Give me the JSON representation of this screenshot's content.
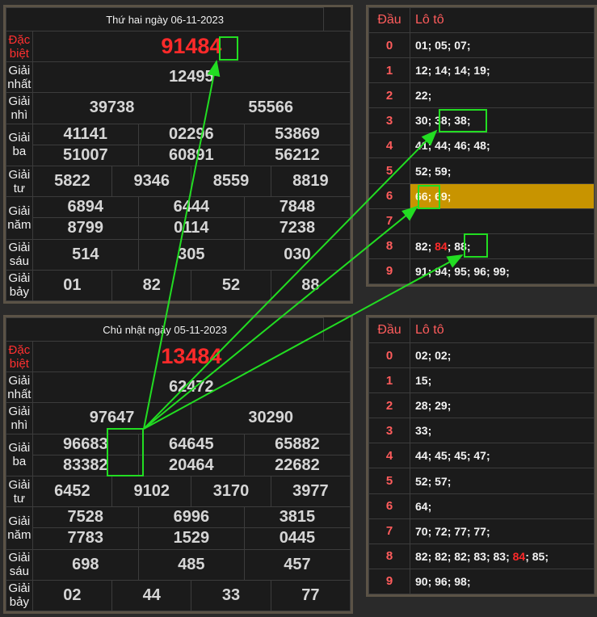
{
  "top_result": {
    "date": "Thứ hai ngày 06-11-2023",
    "rows": [
      {
        "label": "Đặc biệt",
        "nums": [
          "91484"
        ]
      },
      {
        "label": "Giải nhất",
        "nums": [
          "12495"
        ]
      },
      {
        "label": "Giải nhì",
        "nums": [
          "39738",
          "55566"
        ]
      },
      {
        "label": "Giải ba",
        "nums": [
          "41141",
          "02296",
          "53869",
          "51007",
          "60891",
          "56212"
        ]
      },
      {
        "label": "Giải tư",
        "nums": [
          "5822",
          "9346",
          "8559",
          "8819"
        ]
      },
      {
        "label": "Giải năm",
        "nums": [
          "6894",
          "6444",
          "7848",
          "8799",
          "0114",
          "7238"
        ]
      },
      {
        "label": "Giải sáu",
        "nums": [
          "514",
          "305",
          "030"
        ]
      },
      {
        "label": "Giải bảy",
        "nums": [
          "01",
          "82",
          "52",
          "88"
        ]
      }
    ]
  },
  "bottom_result": {
    "date": "Chủ nhật ngày 05-11-2023",
    "rows": [
      {
        "label": "Đặc biệt",
        "nums": [
          "13484"
        ]
      },
      {
        "label": "Giải nhất",
        "nums": [
          "62472"
        ]
      },
      {
        "label": "Giải nhì",
        "nums": [
          "97647",
          "30290"
        ]
      },
      {
        "label": "Giải ba",
        "nums": [
          "96683",
          "64645",
          "65882",
          "83382",
          "20464",
          "22682"
        ]
      },
      {
        "label": "Giải tư",
        "nums": [
          "6452",
          "9102",
          "3170",
          "3977"
        ]
      },
      {
        "label": "Giải năm",
        "nums": [
          "7528",
          "6996",
          "3815",
          "7783",
          "1529",
          "0445"
        ]
      },
      {
        "label": "Giải sáu",
        "nums": [
          "698",
          "485",
          "457"
        ]
      },
      {
        "label": "Giải bảy",
        "nums": [
          "02",
          "44",
          "33",
          "77"
        ]
      }
    ]
  },
  "top_loto": {
    "head_label": "Đầu",
    "value_label": "Lô tô",
    "rows": [
      {
        "d": "0",
        "v": "01; 05; 07;"
      },
      {
        "d": "1",
        "v": "12; 14; 14; 19;"
      },
      {
        "d": "2",
        "v": "22;"
      },
      {
        "d": "3",
        "v": "30; 38; 38;"
      },
      {
        "d": "4",
        "v": "41; 44; 46; 48;"
      },
      {
        "d": "5",
        "v": "52; 59;"
      },
      {
        "d": "6",
        "v": "66; 69;"
      },
      {
        "d": "7",
        "v": ""
      },
      {
        "d": "8",
        "v": "82; 84; 88;"
      },
      {
        "d": "9",
        "v": "91; 94; 95; 96; 99;"
      }
    ]
  },
  "bottom_loto": {
    "head_label": "Đầu",
    "value_label": "Lô tô",
    "rows": [
      {
        "d": "0",
        "v": "02; 02;"
      },
      {
        "d": "1",
        "v": "15;"
      },
      {
        "d": "2",
        "v": "28; 29;"
      },
      {
        "d": "3",
        "v": "33;"
      },
      {
        "d": "4",
        "v": "44; 45; 45; 47;"
      },
      {
        "d": "5",
        "v": "52; 57;"
      },
      {
        "d": "6",
        "v": "64;"
      },
      {
        "d": "7",
        "v": "70; 72; 77; 77;"
      },
      {
        "d": "8",
        "v": "82; 82; 82; 83; 83; 84; 85;"
      },
      {
        "d": "9",
        "v": "90; 96; 98;"
      }
    ]
  },
  "colors": {
    "highlight": "#c89400",
    "special": "#ff2a2a",
    "arrow": "#22dd22",
    "border": "#5b5346"
  }
}
